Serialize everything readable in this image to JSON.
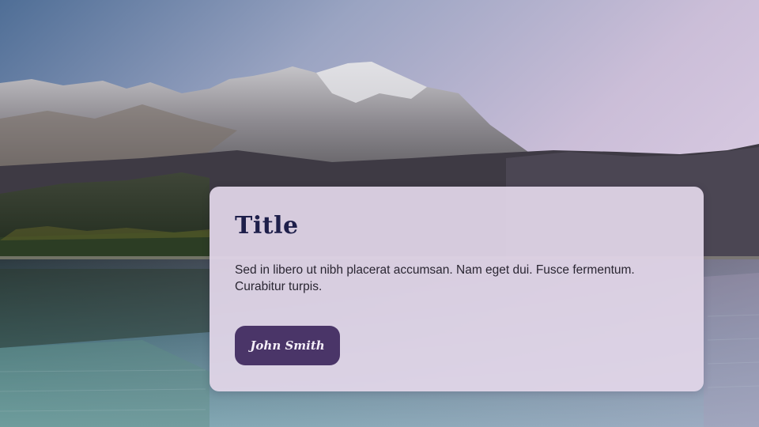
{
  "card": {
    "title": "Title",
    "body": "Sed in libero ut nibh placerat accumsan. Nam eget dui. Fusce fermentum. Curabitur turpis.",
    "button_label": "John Smith"
  },
  "colors": {
    "card_background": "#e2d6e8",
    "title": "#1e1f4a",
    "button": "#4a3568",
    "button_text": "#f4eef8"
  },
  "background": {
    "scene": "mountain-lake-landscape"
  }
}
